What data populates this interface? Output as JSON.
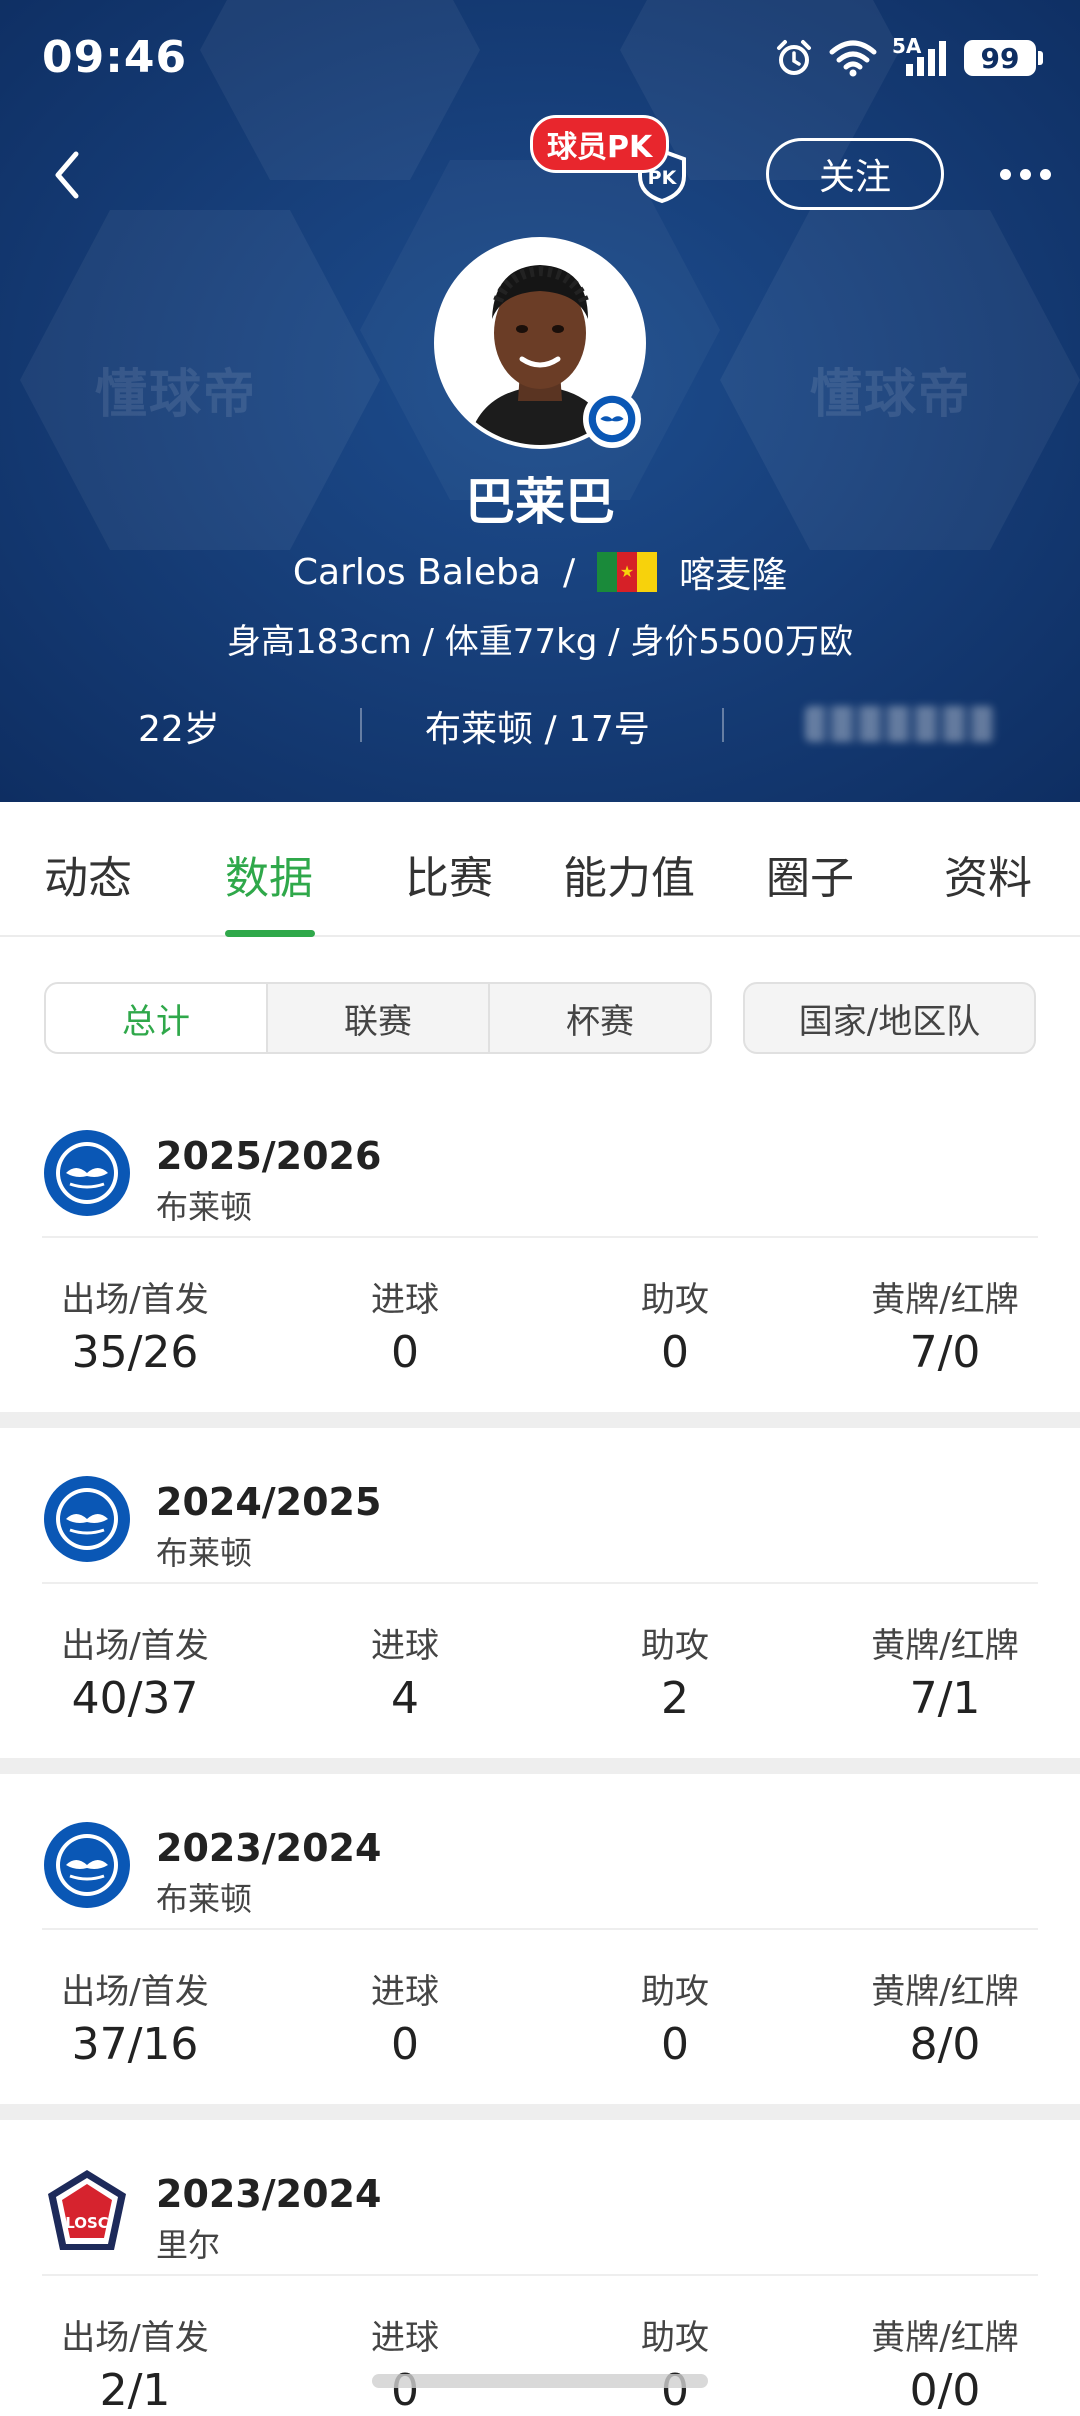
{
  "status_bar": {
    "time": "09:46",
    "network": "5A",
    "battery": "99"
  },
  "header": {
    "pk_badge": "球员PK",
    "pk_icon_text": "PK",
    "follow_label": "关注",
    "watermark": "懂球帝",
    "player_name_cn": "巴莱巴",
    "player_name_en": "Carlos Baleba",
    "name_separator": "/",
    "nationality": "喀麦隆",
    "info": "身高183cm / 体重77kg / 身价5500万欧",
    "age": "22岁",
    "club_number": "布莱顿 / 17号"
  },
  "tabs": [
    {
      "label": "动态",
      "active": false
    },
    {
      "label": "数据",
      "active": true
    },
    {
      "label": "比赛",
      "active": false
    },
    {
      "label": "能力值",
      "active": false
    },
    {
      "label": "圈子",
      "active": false
    },
    {
      "label": "资料",
      "active": false
    }
  ],
  "filters": {
    "segments": [
      {
        "label": "总计",
        "active": true
      },
      {
        "label": "联赛",
        "active": false
      },
      {
        "label": "杯赛",
        "active": false
      }
    ],
    "national": "国家/地区队"
  },
  "stat_labels": {
    "apps": "出场/首发",
    "goals": "进球",
    "assists": "助攻",
    "cards": "黄牌/红牌"
  },
  "seasons": [
    {
      "season": "2025/2026",
      "team": "布莱顿",
      "apps": "35/26",
      "goals": "0",
      "assists": "0",
      "cards": "7/0"
    },
    {
      "season": "2024/2025",
      "team": "布莱顿",
      "apps": "40/37",
      "goals": "4",
      "assists": "2",
      "cards": "7/1"
    },
    {
      "season": "2023/2024",
      "team": "布莱顿",
      "apps": "37/16",
      "goals": "0",
      "assists": "0",
      "cards": "8/0"
    },
    {
      "season": "2023/2024",
      "team": "里尔",
      "apps": "2/1",
      "goals": "0",
      "assists": "0",
      "cards": "0/0"
    }
  ],
  "colors": {
    "header_bg": "#173f7a",
    "accent_green": "#2fa84a",
    "pk_red": "#e8262d",
    "brighton_blue": "#0a57b5",
    "lille_red": "#d6232e"
  }
}
